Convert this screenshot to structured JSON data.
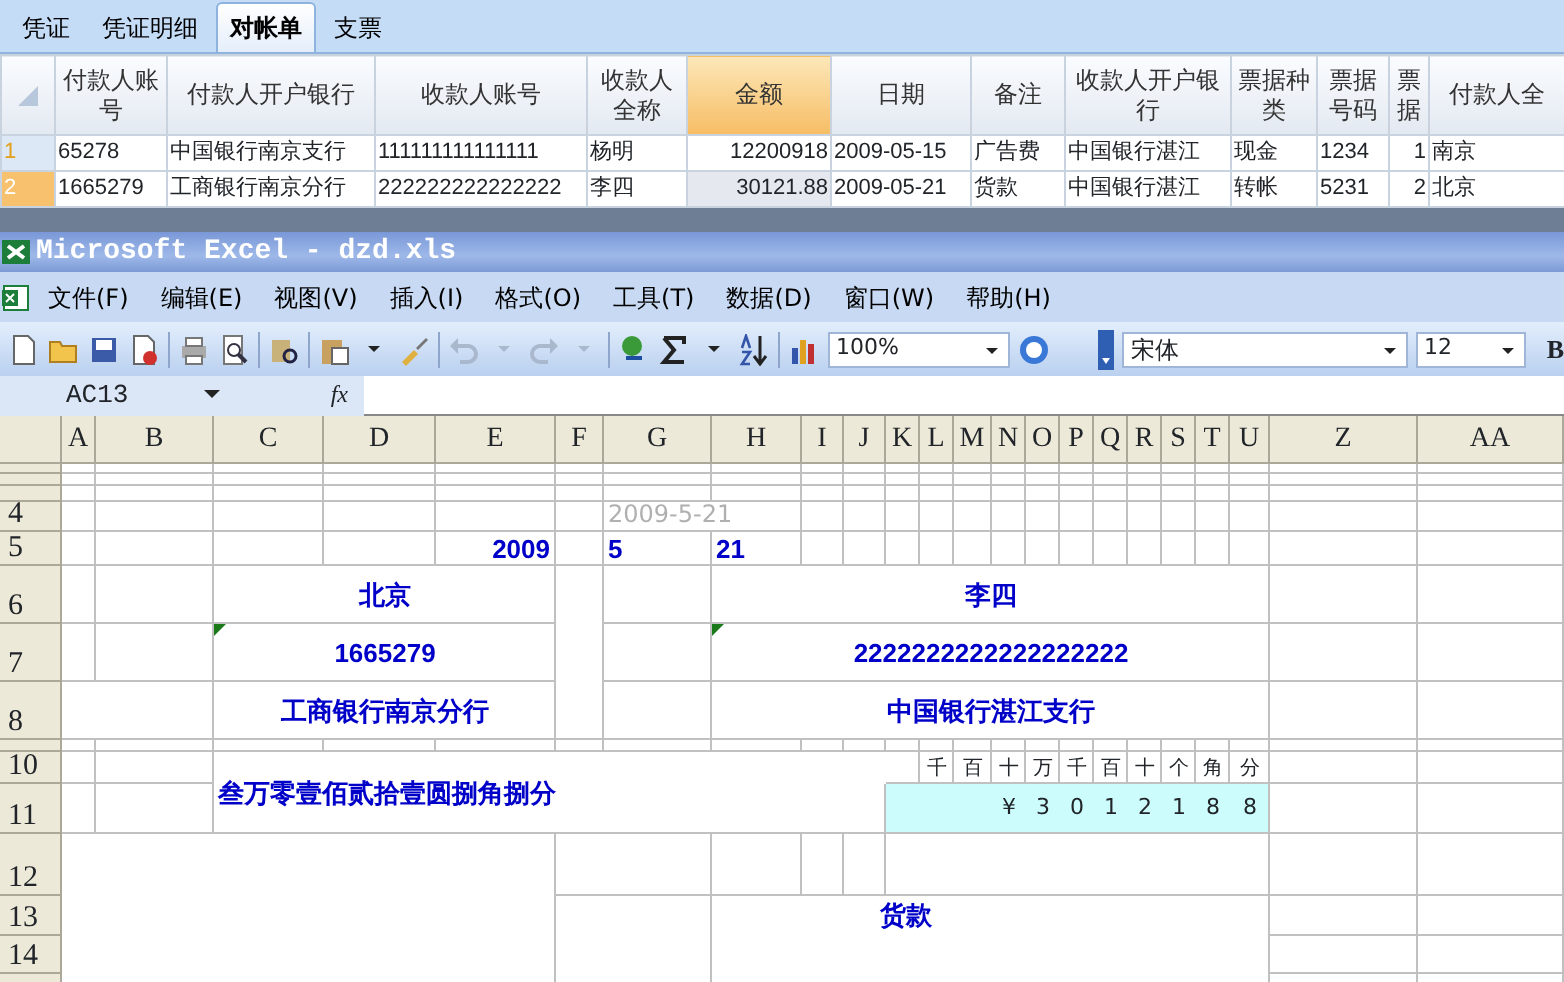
{
  "app_tabs": [
    {
      "label": "凭证",
      "selected": false
    },
    {
      "label": "凭证明细",
      "selected": false
    },
    {
      "label": "对帐单",
      "selected": true
    },
    {
      "label": "支票",
      "selected": false
    }
  ],
  "table": {
    "columns": [
      {
        "label": "付款人账号",
        "selected": false
      },
      {
        "label": "付款人开户银行",
        "selected": false
      },
      {
        "label": "收款人账号",
        "selected": false
      },
      {
        "label": "收款人全称",
        "selected": false
      },
      {
        "label": "金额",
        "selected": true
      },
      {
        "label": "日期",
        "selected": false
      },
      {
        "label": "备注",
        "selected": false
      },
      {
        "label": "收款人开户银行",
        "selected": false
      },
      {
        "label": "票据种类",
        "selected": false
      },
      {
        "label": "票据号码",
        "selected": false
      },
      {
        "label": "票据",
        "selected": false
      },
      {
        "label": "付款人全",
        "selected": false
      }
    ],
    "rows": [
      {
        "number": "1",
        "selected": false,
        "cells": [
          "65278",
          "中国银行南京支行",
          "111111111111111",
          "杨明",
          "12200918",
          "2009-05-15",
          "广告费",
          "中国银行湛江",
          "现金",
          "1234",
          "1",
          "南京"
        ]
      },
      {
        "number": "2",
        "selected": true,
        "cells": [
          "1665279",
          "工商银行南京分行",
          "222222222222222",
          "李四",
          "30121.88",
          "2009-05-21",
          "货款",
          "中国银行湛江",
          "转帐",
          "5231",
          "2",
          "北京"
        ]
      }
    ]
  },
  "excel": {
    "title": "Microsoft Excel - dzd.xls",
    "menu": [
      "文件(F)",
      "编辑(E)",
      "视图(V)",
      "插入(I)",
      "格式(O)",
      "工具(T)",
      "数据(D)",
      "窗口(W)",
      "帮助(H)"
    ],
    "zoom": "100%",
    "font": "宋体",
    "font_size": "12",
    "bold_button": "B",
    "name_box": "AC13",
    "fx": "fx",
    "columns": [
      "A",
      "B",
      "C",
      "D",
      "E",
      "F",
      "G",
      "H",
      "I",
      "J",
      "K",
      "L",
      "M",
      "N",
      "O",
      "P",
      "Q",
      "R",
      "S",
      "T",
      "U",
      "Z",
      "AA"
    ],
    "row_labels": [
      "4",
      "5",
      "6",
      "7",
      "8",
      "10",
      "11",
      "12",
      "13",
      "14"
    ],
    "cells": [
      {
        "text": "2009-5-21",
        "kind": "hint"
      },
      {
        "text": "2009",
        "kind": "value"
      },
      {
        "text": "5",
        "kind": "value"
      },
      {
        "text": "21",
        "kind": "value"
      },
      {
        "text": "北京",
        "kind": "value"
      },
      {
        "text": "李四",
        "kind": "value"
      },
      {
        "text": "1665279",
        "kind": "value",
        "flagged": true
      },
      {
        "text": "2222222222222222222",
        "kind": "value",
        "flagged": true
      },
      {
        "text": "工商银行南京分行",
        "kind": "value"
      },
      {
        "text": "中国银行湛江支行",
        "kind": "value"
      },
      {
        "text": "叁万零壹佰贰拾壹圆捌角捌分",
        "kind": "value"
      },
      {
        "text": "千",
        "kind": "label"
      },
      {
        "text": "百",
        "kind": "label"
      },
      {
        "text": "十",
        "kind": "label"
      },
      {
        "text": "万",
        "kind": "label"
      },
      {
        "text": "千",
        "kind": "label"
      },
      {
        "text": "百",
        "kind": "label"
      },
      {
        "text": "十",
        "kind": "label"
      },
      {
        "text": "个",
        "kind": "label"
      },
      {
        "text": "角",
        "kind": "label"
      },
      {
        "text": "分",
        "kind": "label"
      },
      {
        "text": "¥",
        "kind": "digit"
      },
      {
        "text": "3",
        "kind": "digit"
      },
      {
        "text": "0",
        "kind": "digit"
      },
      {
        "text": "1",
        "kind": "digit"
      },
      {
        "text": "2",
        "kind": "digit"
      },
      {
        "text": "1",
        "kind": "digit"
      },
      {
        "text": "8",
        "kind": "digit"
      },
      {
        "text": "8",
        "kind": "digit"
      },
      {
        "text": "货款",
        "kind": "value"
      }
    ]
  }
}
